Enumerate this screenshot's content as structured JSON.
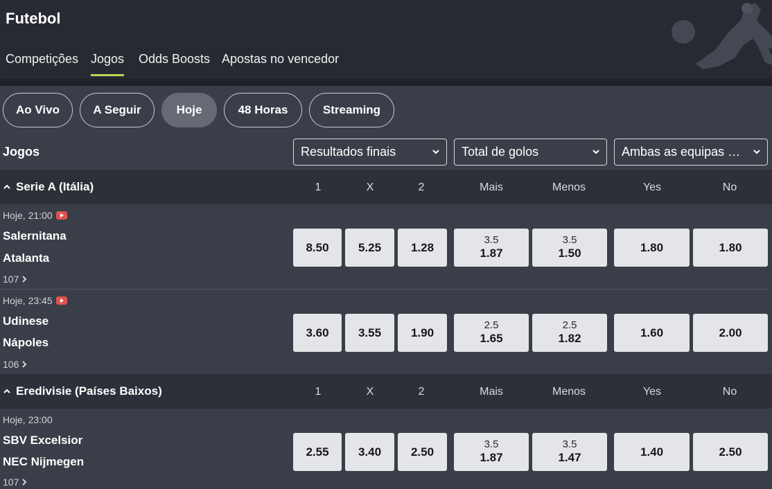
{
  "header": {
    "title": "Futebol",
    "nav": [
      {
        "label": "Competições",
        "active": false
      },
      {
        "label": "Jogos",
        "active": true
      },
      {
        "label": "Odds Boosts",
        "active": false
      },
      {
        "label": "Apostas no vencedor",
        "active": false
      }
    ]
  },
  "filters": [
    {
      "label": "Ao Vivo",
      "active": false
    },
    {
      "label": "A Seguir",
      "active": false
    },
    {
      "label": "Hoje",
      "active": true
    },
    {
      "label": "48 Horas",
      "active": false
    },
    {
      "label": "Streaming",
      "active": false
    }
  ],
  "games_label": "Jogos",
  "market_selects": [
    {
      "value": "Resultados finais"
    },
    {
      "value": "Total de golos"
    },
    {
      "value": "Ambas as equipas marcam"
    }
  ],
  "column_headers": [
    "1",
    "X",
    "2",
    "Mais",
    "Menos",
    "Yes",
    "No"
  ],
  "leagues": [
    {
      "name": "Serie A (Itália)",
      "matches": [
        {
          "time": "Hoje, 21:00",
          "has_stream_icon": true,
          "home": "Salernitana",
          "away": "Atalanta",
          "more_markets": "107",
          "odds": {
            "home": "8.50",
            "draw": "5.25",
            "away": "1.28",
            "over_line": "3.5",
            "over": "1.87",
            "under_line": "3.5",
            "under": "1.50",
            "yes": "1.80",
            "no": "1.80"
          }
        },
        {
          "time": "Hoje, 23:45",
          "has_stream_icon": true,
          "home": "Udinese",
          "away": "Nápoles",
          "more_markets": "106",
          "odds": {
            "home": "3.60",
            "draw": "3.55",
            "away": "1.90",
            "over_line": "2.5",
            "over": "1.65",
            "under_line": "2.5",
            "under": "1.82",
            "yes": "1.60",
            "no": "2.00"
          }
        }
      ]
    },
    {
      "name": "Eredivisie (Países Baixos)",
      "matches": [
        {
          "time": "Hoje, 23:00",
          "has_stream_icon": false,
          "home": "SBV Excelsior",
          "away": "NEC Nijmegen",
          "more_markets": "107",
          "odds": {
            "home": "2.55",
            "draw": "3.40",
            "away": "2.50",
            "over_line": "3.5",
            "over": "1.87",
            "under_line": "3.5",
            "under": "1.47",
            "yes": "1.40",
            "no": "2.50"
          }
        }
      ]
    }
  ],
  "colors": {
    "page_bg": "#3a3e48",
    "header_bg": "#272a32",
    "league_bg": "#2d3038",
    "odd_button_bg": "#e4e5e8",
    "active_tab_underline": "#b7d957",
    "stream_icon": "#e0524f"
  },
  "icons": {
    "select_arrow": "chevron-down-icon",
    "league_toggle": "chevron-up-icon",
    "more_markets": "chevron-right-icon",
    "stream": "tv-stream-icon"
  }
}
